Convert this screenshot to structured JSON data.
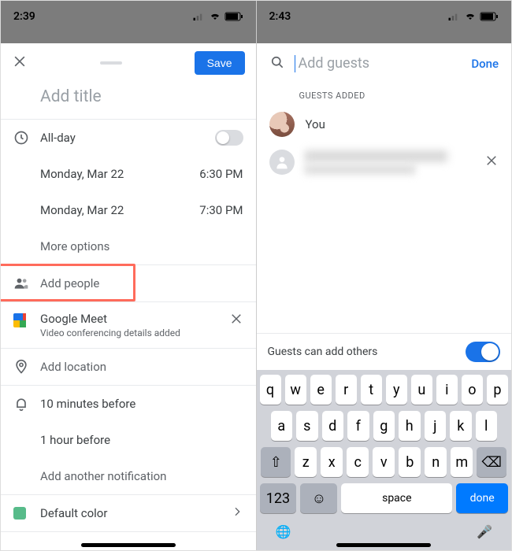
{
  "left": {
    "status_time": "2:39",
    "save_label": "Save",
    "title_placeholder": "Add title",
    "allday_label": "All-day",
    "allday_on": false,
    "start_date": "Monday, Mar 22",
    "start_time": "6:30 PM",
    "end_date": "Monday, Mar 22",
    "end_time": "7:30 PM",
    "more_options": "More options",
    "add_people": "Add people",
    "meet_title": "Google Meet",
    "meet_sub": "Video conferencing details added",
    "add_location": "Add location",
    "notif1": "10 minutes before",
    "notif2": "1 hour before",
    "notif_add": "Add another notification",
    "color_label": "Default color",
    "highlight_target": "add-people-row"
  },
  "right": {
    "status_time": "2:43",
    "search_placeholder": "Add guests",
    "done_label": "Done",
    "section_label": "GUESTS ADDED",
    "guests": [
      {
        "name": "You",
        "sub": ""
      },
      {
        "name": "████████████████",
        "sub": "██████████████"
      }
    ],
    "option_label": "Guests can add others",
    "option_on": true,
    "keyboard": {
      "row1": [
        "q",
        "w",
        "e",
        "r",
        "t",
        "y",
        "u",
        "i",
        "o",
        "p"
      ],
      "row2": [
        "a",
        "s",
        "d",
        "f",
        "g",
        "h",
        "j",
        "k",
        "l"
      ],
      "row3": [
        "z",
        "x",
        "c",
        "v",
        "b",
        "n",
        "m"
      ],
      "shift": "⇧",
      "backspace": "⌫",
      "numbers": "123",
      "emoji": "☺",
      "space": "space",
      "done": "done",
      "globe": "🌐",
      "mic": "🎤"
    }
  }
}
